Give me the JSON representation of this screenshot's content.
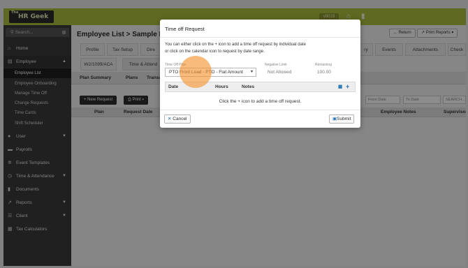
{
  "app": {
    "logo_main": "HR Geek",
    "logo_small": "The",
    "version": "v9019"
  },
  "sidebar": {
    "search_placeholder": "Search...",
    "items": [
      {
        "label": "Home",
        "icon": "home-icon"
      },
      {
        "label": "Employee",
        "icon": "id-card-icon"
      },
      {
        "label": "User",
        "icon": "user-icon"
      },
      {
        "label": "Payrolls",
        "icon": "money-icon"
      },
      {
        "label": "Event Templates",
        "icon": "gear-icon"
      },
      {
        "label": "Time & Attendance",
        "icon": "clock-icon"
      },
      {
        "label": "Documents",
        "icon": "document-icon"
      },
      {
        "label": "Reports",
        "icon": "chart-icon"
      },
      {
        "label": "Client",
        "icon": "list-icon"
      },
      {
        "label": "Tax Calculators",
        "icon": "calculator-icon"
      }
    ],
    "employee_sub": [
      "Employee List",
      "Employee Onboarding",
      "Manage Time Off",
      "Change Requests",
      "Time Cards",
      "Shift Scheduler"
    ]
  },
  "main": {
    "page_title": "Employee List > Sample Emp",
    "return_label": "Return",
    "print_reports_label": "Print Reports",
    "tabs_row1": [
      "Profile",
      "Tax Setup",
      "Dire",
      "ry",
      "Events",
      "Attachments",
      "Check"
    ],
    "tabs_row2": [
      "W2/1099/ACA",
      "Time & Attend"
    ],
    "subtabs": [
      "Plan Summary",
      "Plans",
      "Transa"
    ],
    "new_request_label": "New Request",
    "print_label": "Print",
    "from_date_placeholder": "From Date",
    "to_date_placeholder": "To Date",
    "search_placeholder": "SEARCH...",
    "columns": [
      "Plan",
      "Request Date",
      "Employee Notes",
      "Supervisor"
    ]
  },
  "modal": {
    "title": "Time off Request",
    "instruction_line1": "You can either click on the + icon to add a time off request by individual date",
    "instruction_line2": "or click on the calendar icon to request by date range.",
    "plan_label": "Time Off Plan",
    "plan_value": "PTO Front Load - PTO - Flat Amount",
    "negative_limit_label": "Negative Limit",
    "negative_limit_value": "Not Allowed",
    "remaining_label": "Remaining",
    "remaining_value": "100.00",
    "table_columns": [
      "Date",
      "Hours",
      "Notes"
    ],
    "empty_text": "Click the + icon to add a time off request.",
    "cancel_label": "Cancel",
    "submit_label": "Submit"
  },
  "colors": {
    "accent_green": "#aebf3f",
    "sidebar_bg": "#3b3b3b",
    "highlight": "#f4922c",
    "link_blue": "#1f6fb5"
  }
}
